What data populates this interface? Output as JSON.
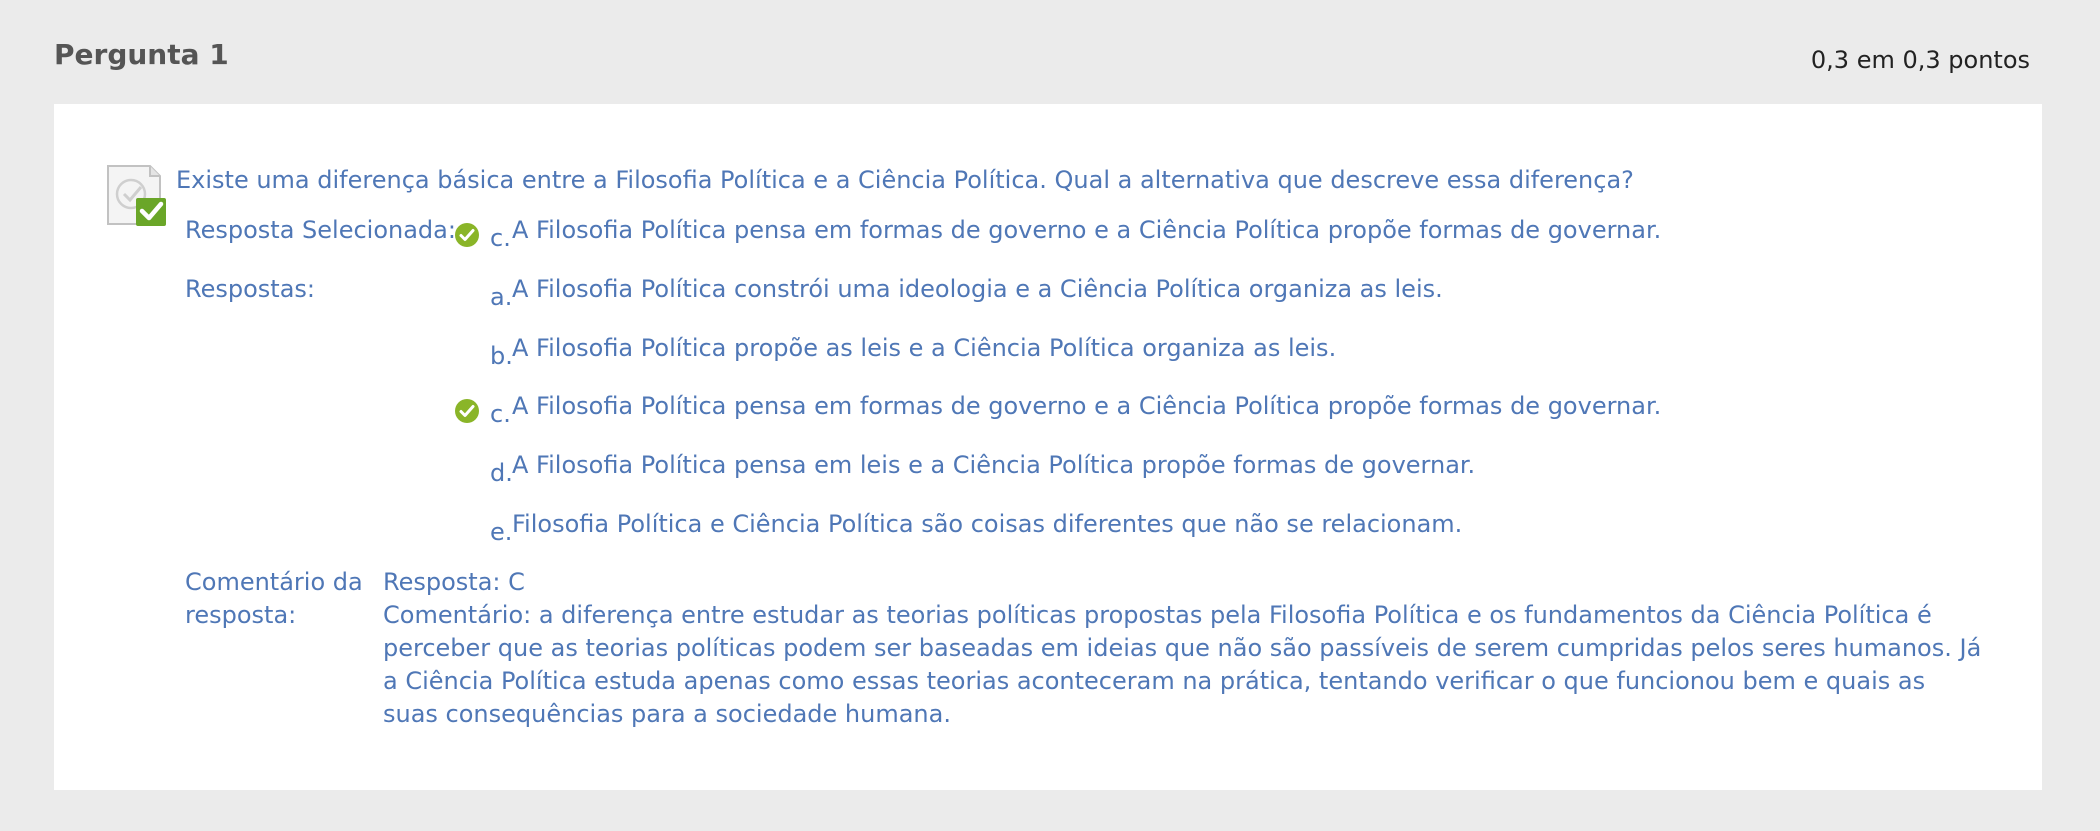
{
  "question": {
    "title": "Pergunta 1",
    "points": "0,3 em 0,3 pontos",
    "text": "Existe uma diferença básica entre a Filosofia Política e a Ciência Política. Qual a alternativa que descreve essa diferença?",
    "selected_label": "Resposta Selecionada:",
    "selected": {
      "letter": "c.",
      "text": "A Filosofia Política pensa em formas de governo e a Ciência Política propõe formas de governar."
    },
    "answers_label": "Respostas:",
    "answers": [
      {
        "letter": "a.",
        "text": "A Filosofia Política constrói uma ideologia e a Ciência Política organiza as leis.",
        "correct": false
      },
      {
        "letter": "b.",
        "text": "A Filosofia Política propõe as leis e a Ciência Política organiza as leis.",
        "correct": false
      },
      {
        "letter": "c.",
        "text": "A Filosofia Política pensa em formas de governo e a Ciência Política propõe formas de governar.",
        "correct": true
      },
      {
        "letter": "d.",
        "text": "A Filosofia Política pensa em leis e a Ciência Política propõe formas de governar.",
        "correct": false
      },
      {
        "letter": "e.",
        "text": "Filosofia Política e Ciência Política são coisas diferentes que não se relacionam.",
        "correct": false
      }
    ],
    "comment_label": "Comentário da resposta:",
    "comment_answer": "Resposta: C",
    "comment_text": "Comentário: a diferença entre estudar as teorias políticas propostas pela Filosofia Política e os fundamentos da Ciência Política é perceber que as teorias políticas podem ser baseadas em ideias que não são passíveis de serem cumpridas pelos seres humanos. Já a Ciência Política estuda apenas como essas teorias aconteceram na prática, tentando verificar o que funcionou bem e quais as suas consequências para a sociedade humana."
  },
  "icons": {
    "question_status": "correct-document-icon",
    "correct_marker": "check-circle-icon"
  },
  "colors": {
    "background": "#ebebeb",
    "card": "#ffffff",
    "text_blue": "#4f77b6",
    "title_gray": "#555555",
    "check_green": "#8ab528"
  }
}
